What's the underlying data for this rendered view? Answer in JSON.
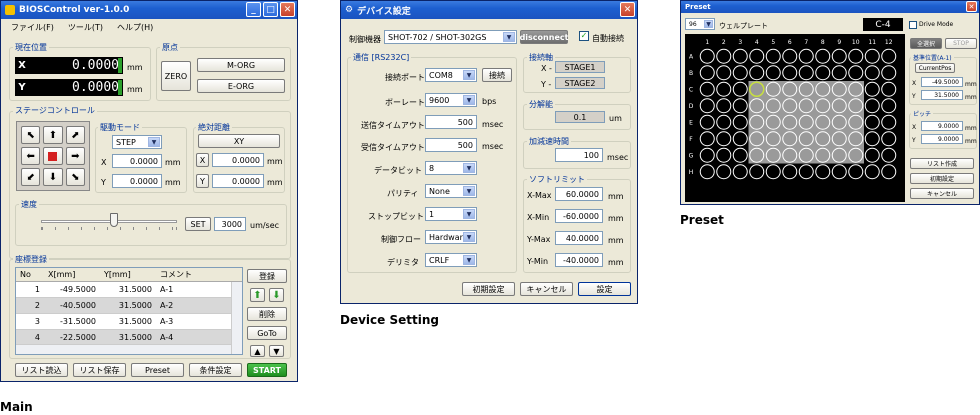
{
  "main": {
    "title": "BIOSControl ver-1.0.0",
    "menu": [
      "ファイル(F)",
      "ツール(T)",
      "ヘルプ(H)"
    ],
    "current_pos_label": "現在位置",
    "x_label": "X",
    "y_label": "Y",
    "x_value": "0.0000",
    "y_value": "0.0000",
    "unit_mm": "mm",
    "origin_label": "原点",
    "zero": "ZERO",
    "morg": "M-ORG",
    "eorg": "E-ORG",
    "stage_control_label": "ステージコントロール",
    "drive_mode_label": "駆動モード",
    "drive_mode_value": "STEP",
    "abs_coord_label": "絶対距離",
    "xy_button": "XY",
    "step_x": "0.0000",
    "step_y": "0.0000",
    "abs_x": "0.0000",
    "abs_y": "0.0000",
    "speed_label": "速度",
    "set_label": "SET",
    "speed_value": "3000",
    "speed_unit": "um/sec",
    "coord_reg_label": "座標登録",
    "table_headers": [
      "No",
      "X[mm]",
      "Y[mm]",
      "コメント"
    ],
    "rows": [
      [
        "1",
        "-49.5000",
        "31.5000",
        "A-1"
      ],
      [
        "2",
        "-40.5000",
        "31.5000",
        "A-2"
      ],
      [
        "3",
        "-31.5000",
        "31.5000",
        "A-3"
      ],
      [
        "4",
        "-22.5000",
        "31.5000",
        "A-4"
      ]
    ],
    "register": "登録",
    "delete": "削除",
    "goto": "GoTo",
    "list_load": "リスト読込",
    "list_save": "リスト保存",
    "preset": "Preset",
    "cond_set": "条件設定",
    "start": "START",
    "caption": "Main"
  },
  "device": {
    "title": "デバイス設定",
    "controller_label": "制御機器",
    "controller_value": "SHOT-702 / SHOT-302GS",
    "disconnect": "disconnect",
    "auto_connect": "自動接続",
    "comm_label": "通信 [RS232C]",
    "port_label": "接続ポート",
    "port_value": "COM8",
    "connect": "接続",
    "baud_label": "ボーレート",
    "baud_value": "9600",
    "baud_unit": "bps",
    "send_to_label": "送信タイムアウト",
    "send_to_value": "500",
    "recv_to_label": "受信タイムアウト",
    "recv_to_value": "500",
    "to_unit": "msec",
    "databit_label": "データビット",
    "databit_value": "8",
    "parity_label": "パリティ",
    "parity_value": "None",
    "stopbit_label": "ストップビット",
    "stopbit_value": "1",
    "flow_label": "制御フロー",
    "flow_value": "Hardware",
    "delim_label": "デリミタ",
    "delim_value": "CRLF",
    "axis_label": "接続軸",
    "axis_x_label": "X -",
    "axis_x_value": "STAGE1",
    "axis_y_label": "Y -",
    "axis_y_value": "STAGE2",
    "resolution_label": "分解能",
    "resolution_value": "0.1",
    "resolution_unit": "um",
    "accel_label": "加減速時間",
    "accel_value": "100",
    "accel_unit": "msec",
    "softlimit_label": "ソフトリミット",
    "xmax_label": "X-Max",
    "xmax_value": "60.0000",
    "xmin_label": "X-Min",
    "xmin_value": "-60.0000",
    "ymax_label": "Y-Max",
    "ymax_value": "40.0000",
    "ymin_label": "Y-Min",
    "ymin_value": "-40.0000",
    "mm": "mm",
    "default_btn": "初期設定",
    "cancel_btn": "キャンセル",
    "set_btn": "設定",
    "caption": "Device Setting"
  },
  "preset": {
    "title": "Preset",
    "plate_value": "96",
    "plate_label": "ウェルプレート",
    "well_id": "C-4",
    "drive_mode": "Drive Mode",
    "select_all": "全選択",
    "stop": "STOP",
    "base_label": "基準位置(A-1)",
    "current_pos": "CurrentPos",
    "base_x": "-49.5000",
    "base_y": "31.5000",
    "pitch_label": "ピッチ",
    "pitch_x": "9.0000",
    "pitch_y": "9.0000",
    "x": "X",
    "y": "Y",
    "mm": "mm",
    "make_list": "リスト作成",
    "default": "初期設定",
    "cancel": "キャンセル",
    "cols": [
      "1",
      "2",
      "3",
      "4",
      "5",
      "6",
      "7",
      "8",
      "9",
      "10",
      "11",
      "12"
    ],
    "rows": [
      "A",
      "B",
      "C",
      "D",
      "E",
      "F",
      "G",
      "H"
    ],
    "caption": "Preset"
  }
}
